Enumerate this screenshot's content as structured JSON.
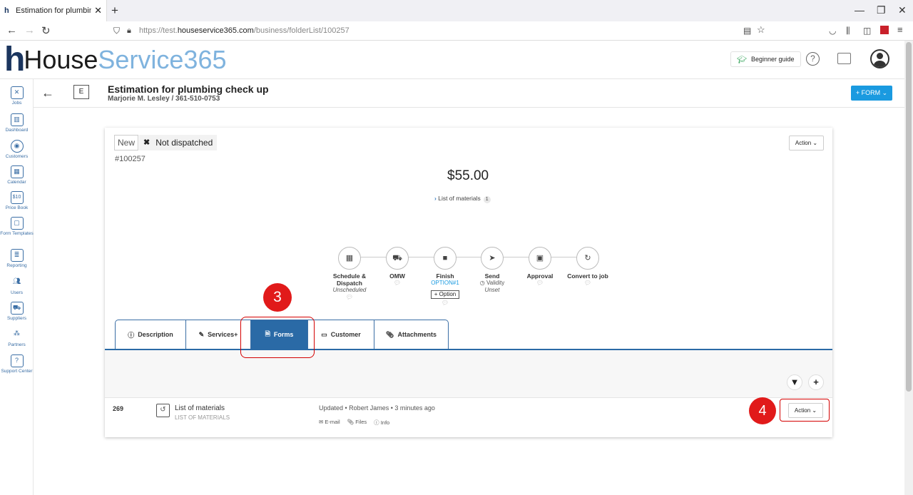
{
  "browser": {
    "tab_title": "Estimation for plumbing check",
    "url_prefix": "https://test.",
    "url_domain": "houseservice365.com",
    "url_path": "/business/folderList/100257"
  },
  "header": {
    "logo_part1": "House",
    "logo_part2": "Service365",
    "beginner_guide": "Beginner guide"
  },
  "sidebar": {
    "items": [
      {
        "label": "Jobs",
        "icon": "wrench-icon"
      },
      {
        "label": "Dashboard",
        "icon": "chart-icon"
      },
      {
        "label": "Customers",
        "icon": "customers-icon"
      },
      {
        "label": "Calendar",
        "icon": "calendar-icon"
      },
      {
        "label": "Price Book",
        "icon": "pricebook-icon"
      },
      {
        "label": "Form Templates",
        "icon": "form-icon"
      },
      {
        "label": "Reporting",
        "icon": "report-icon"
      },
      {
        "label": "Users",
        "icon": "users-icon"
      },
      {
        "label": "Suppliers",
        "icon": "truck-icon"
      },
      {
        "label": "Partners",
        "icon": "partners-icon"
      },
      {
        "label": "Support Center",
        "icon": "support-icon"
      }
    ]
  },
  "job": {
    "type_letter": "E",
    "title": "Estimation for plumbing check up",
    "subtitle": "Marjorie M. Lesley / 361-510-0753",
    "form_button": "+ FORM ⌄",
    "status_new": "New",
    "status_dispatch": "Not dispatched",
    "number": "#100257",
    "action": "Action",
    "price": "$55.00",
    "materials_link": "List of materials",
    "materials_count": "1"
  },
  "workflow": [
    {
      "label": "Schedule & Dispatch",
      "sub": "Unscheduled"
    },
    {
      "label": "OMW",
      "sub": ""
    },
    {
      "label": "Finish",
      "sub": "OPTION#1",
      "button": "+ Option"
    },
    {
      "label": "Send",
      "sub": "Validity",
      "sub2": "Unset"
    },
    {
      "label": "Approval",
      "sub": ""
    },
    {
      "label": "Convert to job",
      "sub": ""
    }
  ],
  "tabs": [
    {
      "label": "Description",
      "icon": "info-icon"
    },
    {
      "label": "Services+",
      "icon": "wrench-icon"
    },
    {
      "label": "Forms",
      "icon": "document-icon"
    },
    {
      "label": "Customer",
      "icon": "id-card-icon"
    },
    {
      "label": "Attachments",
      "icon": "paperclip-icon"
    }
  ],
  "annotations": {
    "first": "3",
    "second": "4"
  },
  "form_row": {
    "id": "269",
    "title": "List of materials",
    "subtitle": "LIST OF MATERIALS",
    "updated": "Updated • Robert James • 3 minutes ago",
    "links": [
      "E-mail",
      "Files",
      "Info"
    ],
    "action": "Action"
  }
}
